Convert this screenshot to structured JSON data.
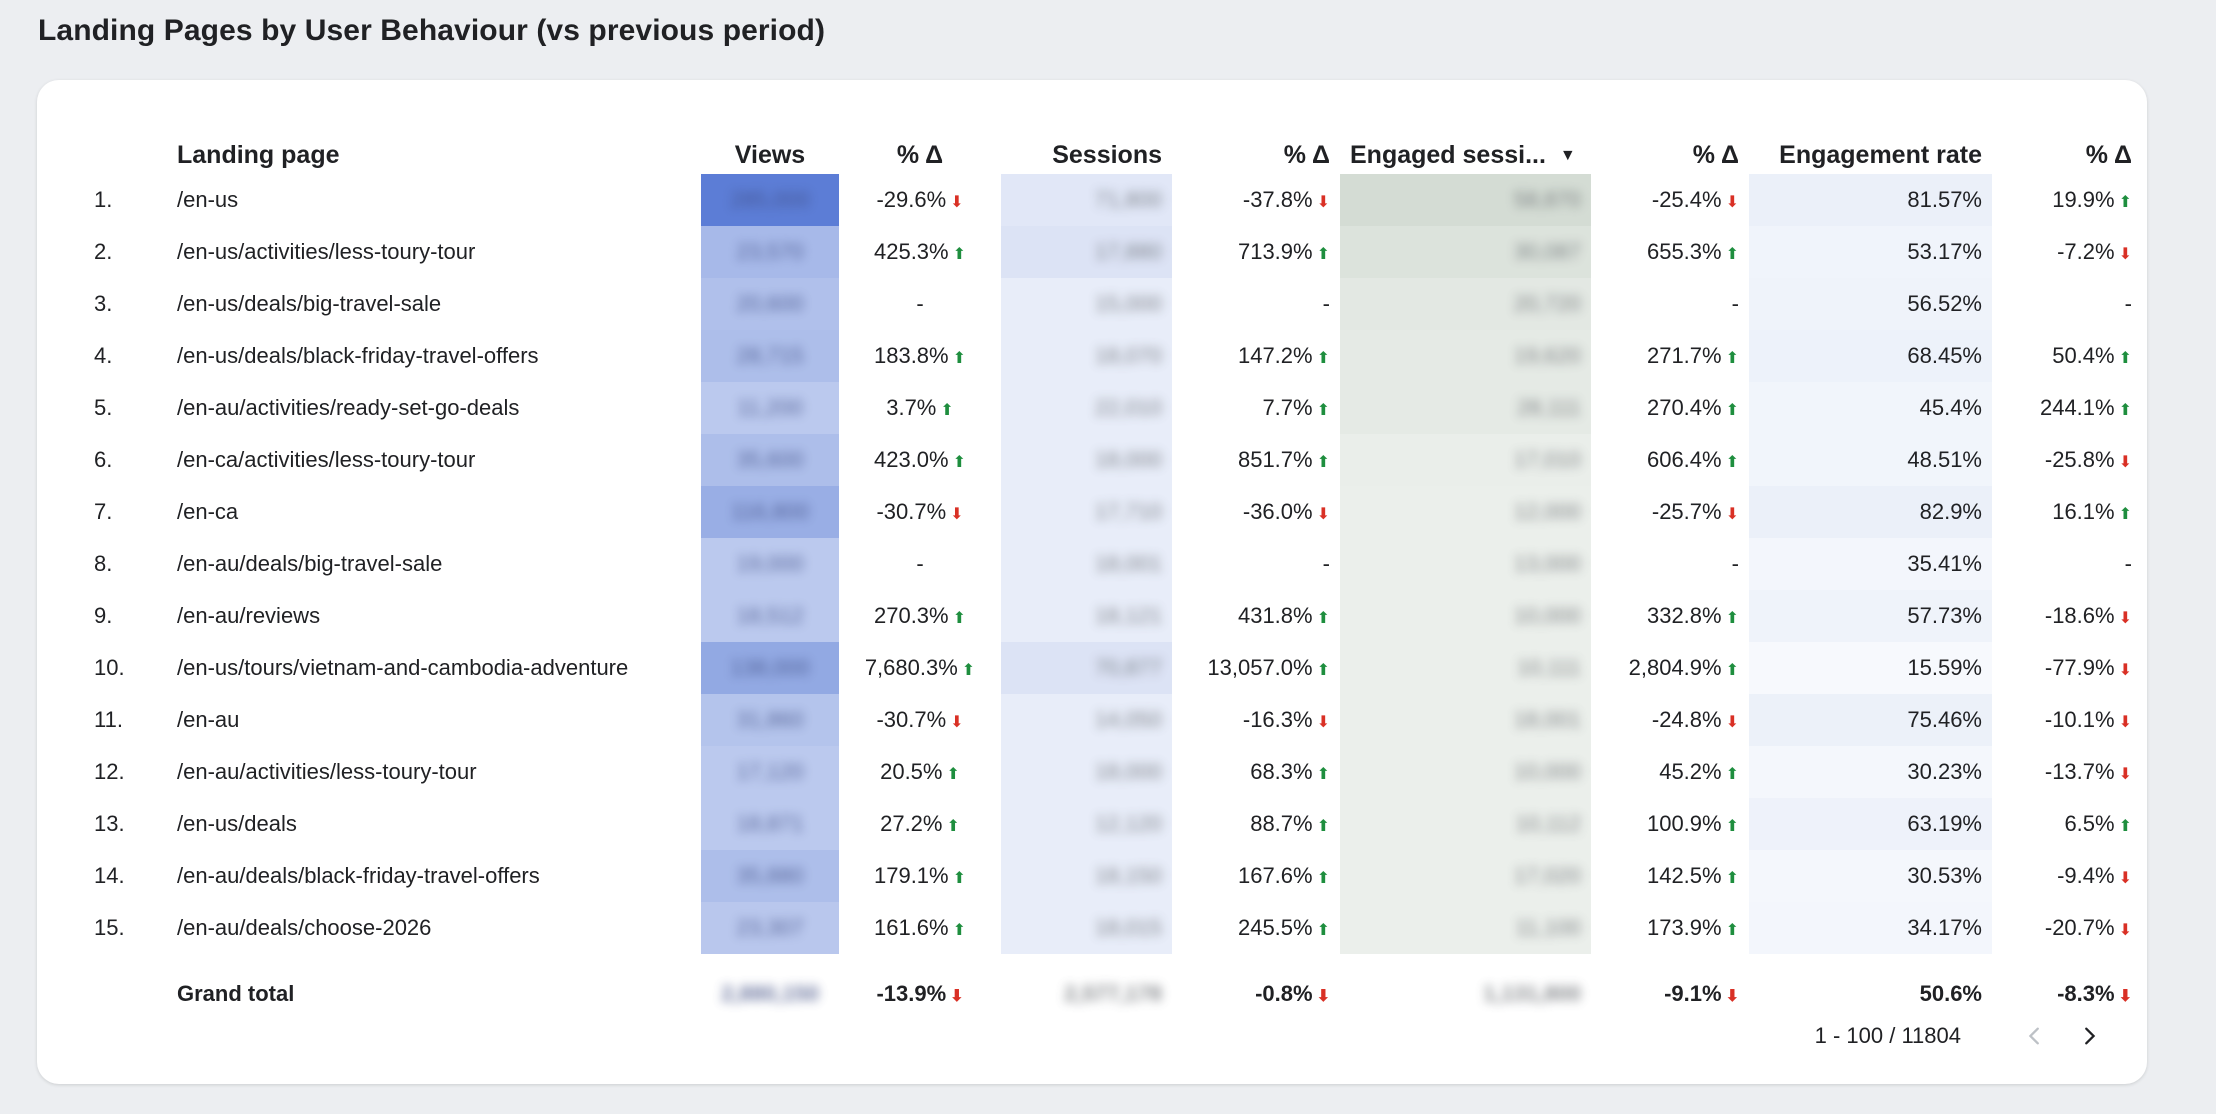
{
  "title": "Landing Pages by User Behaviour (vs previous period)",
  "columns": {
    "landing_page": "Landing page",
    "views": "Views",
    "pct": "% Δ",
    "sessions": "Sessions",
    "engaged_sessions": "Engaged sessi...",
    "engagement_rate": "Engagement rate"
  },
  "rows": [
    {
      "idx": "1.",
      "page": "/en-us",
      "views": "285,000",
      "views_pct": "-29.6%",
      "views_dir": "down",
      "views_level": 1.0,
      "sessions": "71,800",
      "sessions_pct": "-37.8%",
      "sessions_dir": "down",
      "sessions_level": 0.2,
      "engaged": "58,870",
      "engaged_pct": "-25.4%",
      "engaged_dir": "down",
      "engaged_level": 1.0,
      "rate": "81.57%",
      "rate_pct": "19.9%",
      "rate_dir": "up",
      "rate_level": 0.5
    },
    {
      "idx": "2.",
      "page": "/en-us/activities/less-toury-tour",
      "views": "23,570",
      "views_pct": "425.3%",
      "views_dir": "up",
      "views_level": 0.45,
      "sessions": "17,880",
      "sessions_pct": "713.9%",
      "sessions_dir": "up",
      "sessions_level": 0.25,
      "engaged": "30,087",
      "engaged_pct": "655.3%",
      "engaged_dir": "up",
      "engaged_level": 0.75,
      "rate": "53.17%",
      "rate_pct": "-7.2%",
      "rate_dir": "down",
      "rate_level": 0.32
    },
    {
      "idx": "3.",
      "page": "/en-us/deals/big-travel-sale",
      "views": "20,600",
      "views_pct": "-",
      "views_dir": "none",
      "views_level": 0.38,
      "sessions": "15,000",
      "sessions_pct": "-",
      "sessions_dir": "none",
      "sessions_level": 0.12,
      "engaged": "20,720",
      "engaged_pct": "-",
      "engaged_dir": "none",
      "engaged_level": 0.55,
      "rate": "56.52%",
      "rate_pct": "-",
      "rate_dir": "none",
      "rate_level": 0.35
    },
    {
      "idx": "4.",
      "page": "/en-us/deals/black-friday-travel-offers",
      "views": "28,715",
      "views_pct": "183.8%",
      "views_dir": "up",
      "views_level": 0.4,
      "sessions": "18,070",
      "sessions_pct": "147.2%",
      "sessions_dir": "up",
      "sessions_level": 0.12,
      "engaged": "19,620",
      "engaged_pct": "271.7%",
      "engaged_dir": "up",
      "engaged_level": 0.5,
      "rate": "68.45%",
      "rate_pct": "50.4%",
      "rate_dir": "up",
      "rate_level": 0.42
    },
    {
      "idx": "5.",
      "page": "/en-au/activities/ready-set-go-deals",
      "views": "11,200",
      "views_pct": "3.7%",
      "views_dir": "up",
      "views_level": 0.3,
      "sessions": "22,010",
      "sessions_pct": "7.7%",
      "sessions_dir": "up",
      "sessions_level": 0.12,
      "engaged": "28,111",
      "engaged_pct": "270.4%",
      "engaged_dir": "up",
      "engaged_level": 0.5,
      "rate": "45.4%",
      "rate_pct": "244.1%",
      "rate_dir": "up",
      "rate_level": 0.28
    },
    {
      "idx": "6.",
      "page": "/en-ca/activities/less-toury-tour",
      "views": "35,600",
      "views_pct": "423.0%",
      "views_dir": "up",
      "views_level": 0.4,
      "sessions": "18,000",
      "sessions_pct": "851.7%",
      "sessions_dir": "up",
      "sessions_level": 0.12,
      "engaged": "17,010",
      "engaged_pct": "606.4%",
      "engaged_dir": "up",
      "engaged_level": 0.35,
      "rate": "48.51%",
      "rate_pct": "-25.8%",
      "rate_dir": "down",
      "rate_level": 0.3
    },
    {
      "idx": "7.",
      "page": "/en-ca",
      "views": "116,800",
      "views_pct": "-30.7%",
      "views_dir": "down",
      "views_level": 0.55,
      "sessions": "17,710",
      "sessions_pct": "-36.0%",
      "sessions_dir": "down",
      "sessions_level": 0.12,
      "engaged": "12,000",
      "engaged_pct": "-25.7%",
      "engaged_dir": "down",
      "engaged_level": 0.3,
      "rate": "82.9%",
      "rate_pct": "16.1%",
      "rate_dir": "up",
      "rate_level": 0.5
    },
    {
      "idx": "8.",
      "page": "/en-au/deals/big-travel-sale",
      "views": "19,000",
      "views_pct": "-",
      "views_dir": "none",
      "views_level": 0.3,
      "sessions": "18,001",
      "sessions_pct": "-",
      "sessions_dir": "none",
      "sessions_level": 0.12,
      "engaged": "13,000",
      "engaged_pct": "-",
      "engaged_dir": "none",
      "engaged_level": 0.3,
      "rate": "35.41%",
      "rate_pct": "-",
      "rate_dir": "none",
      "rate_level": 0.22
    },
    {
      "idx": "9.",
      "page": "/en-au/reviews",
      "views": "18,512",
      "views_pct": "270.3%",
      "views_dir": "up",
      "views_level": 0.3,
      "sessions": "18,121",
      "sessions_pct": "431.8%",
      "sessions_dir": "up",
      "sessions_level": 0.12,
      "engaged": "10,000",
      "engaged_pct": "332.8%",
      "engaged_dir": "up",
      "engaged_level": 0.3,
      "rate": "57.73%",
      "rate_pct": "-18.6%",
      "rate_dir": "down",
      "rate_level": 0.36
    },
    {
      "idx": "10.",
      "page": "/en-us/tours/vietnam-and-cambodia-adventure",
      "views": "138,000",
      "views_pct": "7,680.3%",
      "views_dir": "up",
      "views_level": 0.6,
      "sessions": "70,877",
      "sessions_pct": "13,057.0%",
      "sessions_dir": "up",
      "sessions_level": 0.25,
      "engaged": "10,111",
      "engaged_pct": "2,804.9%",
      "engaged_dir": "up",
      "engaged_level": 0.3,
      "rate": "15.59%",
      "rate_pct": "-77.9%",
      "rate_dir": "down",
      "rate_level": 0.1
    },
    {
      "idx": "11.",
      "page": "/en-au",
      "views": "31,860",
      "views_pct": "-30.7%",
      "views_dir": "down",
      "views_level": 0.35,
      "sessions": "14,050",
      "sessions_pct": "-16.3%",
      "sessions_dir": "down",
      "sessions_level": 0.12,
      "engaged": "18,001",
      "engaged_pct": "-24.8%",
      "engaged_dir": "down",
      "engaged_level": 0.3,
      "rate": "75.46%",
      "rate_pct": "-10.1%",
      "rate_dir": "down",
      "rate_level": 0.46
    },
    {
      "idx": "12.",
      "page": "/en-au/activities/less-toury-tour",
      "views": "17,120",
      "views_pct": "20.5%",
      "views_dir": "up",
      "views_level": 0.3,
      "sessions": "18,000",
      "sessions_pct": "68.3%",
      "sessions_dir": "up",
      "sessions_level": 0.12,
      "engaged": "10,000",
      "engaged_pct": "45.2%",
      "engaged_dir": "up",
      "engaged_level": 0.3,
      "rate": "30.23%",
      "rate_pct": "-13.7%",
      "rate_dir": "down",
      "rate_level": 0.2
    },
    {
      "idx": "13.",
      "page": "/en-us/deals",
      "views": "18,871",
      "views_pct": "27.2%",
      "views_dir": "up",
      "views_level": 0.3,
      "sessions": "12,120",
      "sessions_pct": "88.7%",
      "sessions_dir": "up",
      "sessions_level": 0.12,
      "engaged": "10,112",
      "engaged_pct": "100.9%",
      "engaged_dir": "up",
      "engaged_level": 0.3,
      "rate": "63.19%",
      "rate_pct": "6.5%",
      "rate_dir": "up",
      "rate_level": 0.4
    },
    {
      "idx": "14.",
      "page": "/en-au/deals/black-friday-travel-offers",
      "views": "35,880",
      "views_pct": "179.1%",
      "views_dir": "up",
      "views_level": 0.4,
      "sessions": "18,150",
      "sessions_pct": "167.6%",
      "sessions_dir": "up",
      "sessions_level": 0.12,
      "engaged": "17,020",
      "engaged_pct": "142.5%",
      "engaged_dir": "up",
      "engaged_level": 0.3,
      "rate": "30.53%",
      "rate_pct": "-9.4%",
      "rate_dir": "down",
      "rate_level": 0.2
    },
    {
      "idx": "15.",
      "page": "/en-au/deals/choose-2026",
      "views": "23,307",
      "views_pct": "161.6%",
      "views_dir": "up",
      "views_level": 0.32,
      "sessions": "18,015",
      "sessions_pct": "245.5%",
      "sessions_dir": "up",
      "sessions_level": 0.12,
      "engaged": "11,100",
      "engaged_pct": "173.9%",
      "engaged_dir": "up",
      "engaged_level": 0.3,
      "rate": "34.17%",
      "rate_pct": "-20.7%",
      "rate_dir": "down",
      "rate_level": 0.22
    }
  ],
  "grand_total": {
    "label": "Grand total",
    "views": "2,880,150",
    "views_pct": "-13.9%",
    "views_dir": "down",
    "sessions": "2,577,178",
    "sessions_pct": "-0.8%",
    "sessions_dir": "down",
    "engaged": "1,131,800",
    "engaged_pct": "-9.1%",
    "engaged_dir": "down",
    "rate": "50.6%",
    "rate_pct": "-8.3%",
    "rate_dir": "down"
  },
  "pagination": {
    "range": "1 - 100 / 11804"
  },
  "colors": {
    "views_heat": "#4a6fd1",
    "sessions_heat": "#c5d1ef",
    "engaged_heat": "#cfd8cf",
    "rate_heat": "#dde6f5",
    "up": "#1e8e3e",
    "down": "#d93025"
  }
}
